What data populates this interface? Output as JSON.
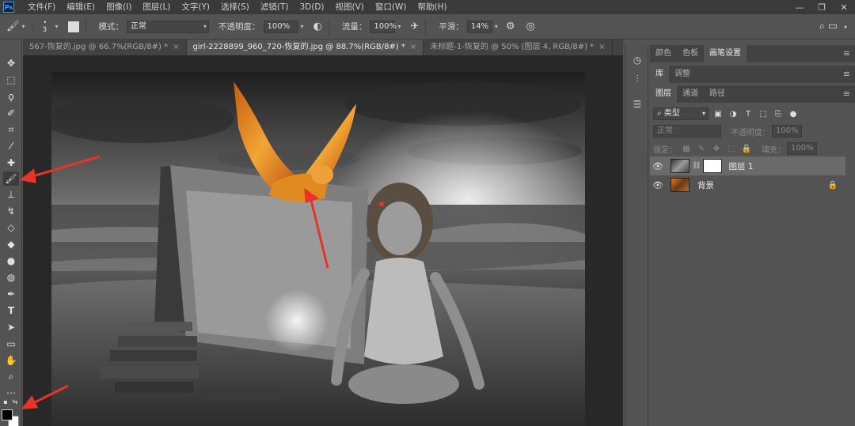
{
  "app": {
    "logo": "Ps"
  },
  "menu": [
    "文件(F)",
    "编辑(E)",
    "图像(I)",
    "图层(L)",
    "文字(Y)",
    "选择(S)",
    "滤镜(T)",
    "3D(D)",
    "视图(V)",
    "窗口(W)",
    "帮助(H)"
  ],
  "window_controls": {
    "minimize": "—",
    "restore": "❐",
    "close": "✕"
  },
  "options": {
    "brush_size": "3",
    "mode_label": "模式：",
    "mode_value": "正常",
    "opacity_label": "不透明度：",
    "opacity_value": "100%",
    "flow_label": "流量：",
    "flow_value": "100%",
    "smooth_label": "平滑：",
    "smooth_value": "14%"
  },
  "tabs": [
    {
      "label": "567-恢复的.jpg @ 66.7%(RGB/8#) *",
      "close": "×"
    },
    {
      "label": "girl-2228899_960_720-恢复的.jpg @ 88.7%(RGB/8#) *",
      "close": "×"
    },
    {
      "label": "未标题-1-恢复的 @ 50% (图层 4, RGB/8#) *",
      "close": "×"
    }
  ],
  "panels": {
    "top_tabs": [
      "颜色",
      "色板",
      "画笔设置"
    ],
    "mid_tabs": [
      "库",
      "调整"
    ],
    "layer_tabs": [
      "图层",
      "通道",
      "路径"
    ],
    "filter_label": "类型",
    "blend_mode": "正常",
    "opacity_label": "不透明度：",
    "opacity_value": "100%",
    "lock_label": "锁定：",
    "fill_label": "填充：",
    "fill_value": "100%",
    "menu_icon": "≡"
  },
  "layers": [
    {
      "name": "图层 1",
      "selected": true
    },
    {
      "name": "背景",
      "locked": true
    }
  ],
  "colors": {
    "accent": "#31a8ff",
    "annotation_arrow": "#e8332b",
    "owl_orange": "#e8901c"
  }
}
